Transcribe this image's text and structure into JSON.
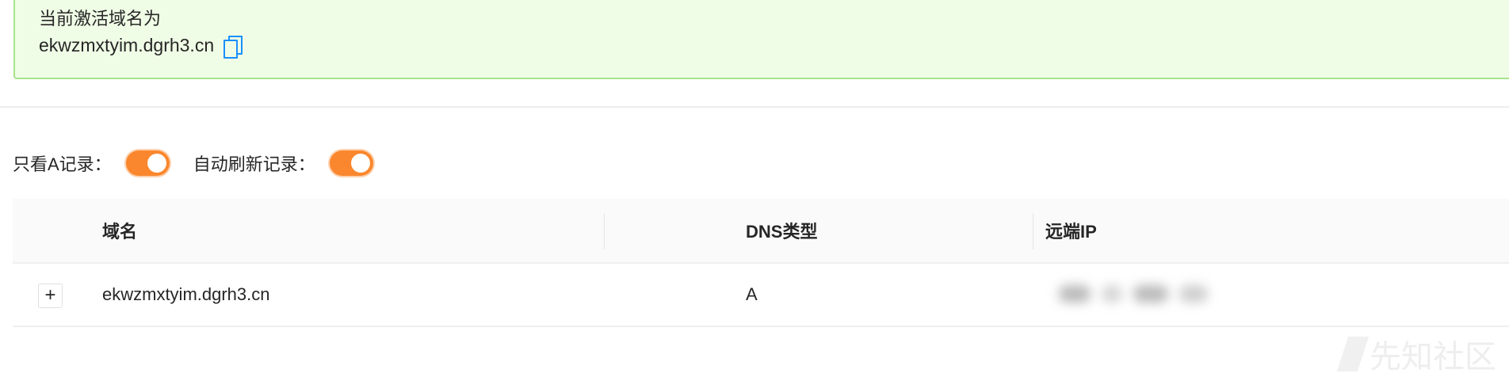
{
  "alert": {
    "title": "当前激活域名为",
    "domain": "ekwzmxtyim.dgrh3.cn",
    "copy_icon": "copy-icon"
  },
  "filters": {
    "only_a_label": "只看A记录：",
    "only_a_on": true,
    "auto_refresh_label": "自动刷新记录：",
    "auto_refresh_on": true
  },
  "table": {
    "columns": [
      "域名",
      "DNS类型",
      "远端IP"
    ],
    "rows": [
      {
        "domain": "ekwzmxtyim.dgrh3.cn",
        "type": "A",
        "ip": ""
      }
    ]
  },
  "watermark": "先知社区",
  "colors": {
    "toggle": "#fa872d",
    "alert_bg": "#f0fde6",
    "alert_border": "#a6e48a",
    "link": "#1890ff"
  }
}
